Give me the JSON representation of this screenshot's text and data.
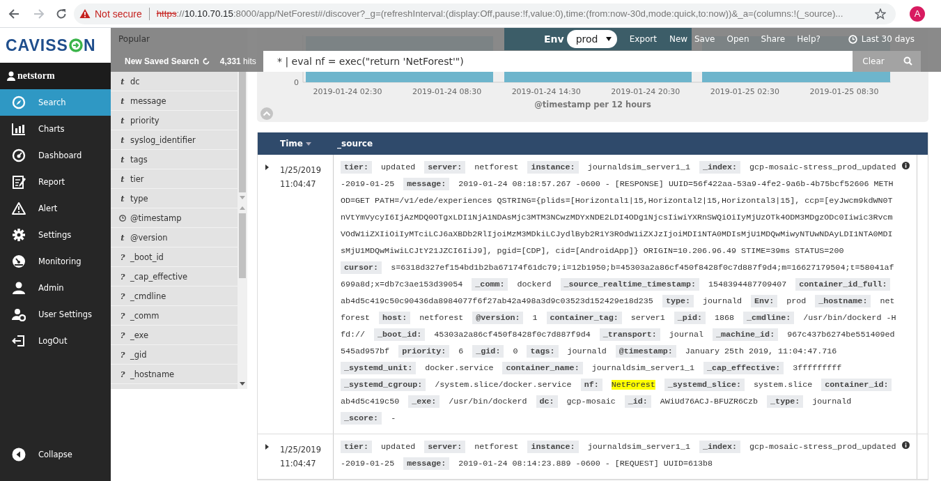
{
  "browser": {
    "security_label": "Not secure",
    "url": [
      {
        "kind": "scheme",
        "text": "https"
      },
      {
        "kind": "plain",
        "text": "://"
      },
      {
        "kind": "host",
        "text": "10.10.70.15"
      },
      {
        "kind": "plain",
        "text": ":8000/app/NetForest#/discover?_g=(refreshInterval:(display:Off,pause:!f,value:0),time:(from:now-30d,mode:quick,to:now))&_a=(columns:!(_source)..."
      }
    ],
    "forward_disabled": true,
    "avatar_letter": "A"
  },
  "sidebar": {
    "logo_parts": [
      "CAVISS",
      "N"
    ],
    "user": "netstorm",
    "items": [
      {
        "label": "Search",
        "selected": true
      },
      {
        "label": "Charts",
        "selected": false
      },
      {
        "label": "Dashboard",
        "selected": false
      },
      {
        "label": "Report",
        "selected": false
      },
      {
        "label": "Alert",
        "selected": false
      },
      {
        "label": "Settings",
        "selected": false
      },
      {
        "label": "Monitoring",
        "selected": false
      },
      {
        "label": "Admin",
        "selected": false
      },
      {
        "label": "User Settings",
        "selected": false
      },
      {
        "label": "LogOut",
        "selected": false
      }
    ],
    "collapse_label": "Collapse"
  },
  "field_list": {
    "heading": "Popular",
    "fields": [
      {
        "kind": "string",
        "type_label": "t",
        "name": "dc"
      },
      {
        "kind": "string",
        "type_label": "t",
        "name": "message"
      },
      {
        "kind": "string",
        "type_label": "t",
        "name": "priority"
      },
      {
        "kind": "string",
        "type_label": "t",
        "name": "syslog_identifier"
      },
      {
        "kind": "string",
        "type_label": "t",
        "name": "tags"
      },
      {
        "kind": "string",
        "type_label": "t",
        "name": "tier"
      },
      {
        "kind": "string",
        "type_label": "t",
        "name": "type"
      },
      {
        "kind": "date",
        "name": "@timestamp"
      },
      {
        "kind": "string",
        "type_label": "t",
        "name": "@version"
      },
      {
        "kind": "unknown",
        "type_label": "?",
        "name": "_boot_id"
      },
      {
        "kind": "unknown",
        "type_label": "?",
        "name": "_cap_effective"
      },
      {
        "kind": "unknown",
        "type_label": "?",
        "name": "_cmdline"
      },
      {
        "kind": "unknown",
        "type_label": "?",
        "name": "_comm"
      },
      {
        "kind": "unknown",
        "type_label": "?",
        "name": "_exe"
      },
      {
        "kind": "unknown",
        "type_label": "?",
        "name": "_gid"
      },
      {
        "kind": "unknown",
        "type_label": "?",
        "name": "_hostname"
      }
    ]
  },
  "toolbar": {
    "saved_search": "New Saved Search",
    "hits": "**4,331** hits",
    "env_label": "Env",
    "env_value": "prod",
    "env_actions": [
      "Export",
      "New"
    ],
    "actions": [
      "Save",
      "Open",
      "Share",
      "Help?"
    ],
    "time_range": "Last 30 days",
    "query": "* | eval nf = exec(\"return 'NetForest'\")",
    "clear_label": "Clear"
  },
  "histogram": {
    "y_tick_labels": [
      "0"
    ],
    "x_tick_labels": [
      "2019-01-24 02:30",
      "2019-01-24 08:30",
      "2019-01-24 14:30",
      "2019-01-24 20:30",
      "2019-01-25 02:30",
      "2019-01-25 08:30"
    ],
    "xlabel": "@timestamp per 12 hours"
  },
  "table": {
    "columns": [
      {
        "label": "Time",
        "sorted": true
      },
      {
        "label": "_source",
        "sorted": false
      }
    ],
    "rows": [
      {
        "expanded": false,
        "time": "1/25/2019 11:04:47",
        "fields": [
          {
            "key": "tier:",
            "value": "updated",
            "highlighted": false
          },
          {
            "key": "server:",
            "value": "netforest",
            "highlighted": false
          },
          {
            "key": "instance:",
            "value": "journaldsim_server1_1",
            "highlighted": false
          },
          {
            "key": "_index:",
            "value": "gcp-mosaic-stress_prod_updated-2019-01-25",
            "highlighted": false
          },
          {
            "key": "message:",
            "value": "2019-01-24 08:18:57.267 -0600 - [RESPONSE] UUID=56f422aa-53a9-4fe2-9a6b-4b75bcf52606 METHOD=GET PATH=/v1/ede/experiences QSTRING={plids=[Horizontal1|15,Horizontal2|15,Horizontal3|15], ccp=[eyJwcm9kdWN0TnVtYmVycyI6IjAzMDQ0OTgxLDI1NjA1NDAsMjc3MTM3NCwzMDYxNDE2LDI4ODg1NjcsIiwiYXRnSWQiOiIyMjUzOTk4ODM3MDgzODc0Iiwic3RvcmVOdW1iZXIiOiIyMTciLCJ6aXBDb2RlIjoiMzM3MDkiLCJydlByb2R1Y3ROdW1iZXJzIjoiMDI1NTA0MDIsMjU1MDQwMiwyNTUwNDAyLDI1NTA0MDIsMjU1MDQwMiwiLCJtY21JZCI6IiJ9], pgid=[CDP], cid=[AndroidApp]} ORIGIN=10.206.96.49 STIME=39ms STATUS=200",
            "highlighted": false
          },
          {
            "key": "cursor:",
            "value": "s=6318d327ef154bd1b2ba67174f61dc79;i=12b1950;b=45303a2a86cf450f8428f0c7d887f9d4;m=16627179504;t=58041af699a8d;x=db7c3ae153d39054",
            "highlighted": false
          },
          {
            "key": "_comm:",
            "value": "dockerd",
            "highlighted": false
          },
          {
            "key": "_source_realtime_timestamp:",
            "value": "1548394487709407",
            "highlighted": false
          },
          {
            "key": "container_id_full:",
            "value": "ab4d5c419c50c90436da8984077f6f27ab42a498a3d9c03523d152429e18d235",
            "highlighted": false
          },
          {
            "key": "type:",
            "value": "journald",
            "highlighted": false
          },
          {
            "key": "Env:",
            "value": "prod",
            "highlighted": false
          },
          {
            "key": "_hostname:",
            "value": "netforest",
            "highlighted": false
          },
          {
            "key": "host:",
            "value": "netforest",
            "highlighted": false
          },
          {
            "key": "@version:",
            "value": "1",
            "highlighted": false
          },
          {
            "key": "container_tag:",
            "value": "server1",
            "highlighted": false
          },
          {
            "key": "_pid:",
            "value": "1868",
            "highlighted": false
          },
          {
            "key": "_cmdline:",
            "value": "/usr/bin/dockerd -H fd://",
            "highlighted": false
          },
          {
            "key": "_boot_id:",
            "value": "45303a2a86cf450f8428f0c7d887f9d4",
            "highlighted": false
          },
          {
            "key": "_transport:",
            "value": "journal",
            "highlighted": false
          },
          {
            "key": "_machine_id:",
            "value": "967c437b6274be551409ed545ad957bf",
            "highlighted": false
          },
          {
            "key": "priority:",
            "value": "6",
            "highlighted": false
          },
          {
            "key": "_gid:",
            "value": "0",
            "highlighted": false
          },
          {
            "key": "tags:",
            "value": "journald",
            "highlighted": false
          },
          {
            "key": "@timestamp:",
            "value": "January 25th 2019, 11:04:47.716",
            "highlighted": false
          },
          {
            "key": "_systemd_unit:",
            "value": "docker.service",
            "highlighted": false
          },
          {
            "key": "container_name:",
            "value": "journaldsim_server1_1",
            "highlighted": false
          },
          {
            "key": "_cap_effective:",
            "value": "3fffffffff",
            "highlighted": false
          },
          {
            "key": "_systemd_cgroup:",
            "value": "/system.slice/docker.service",
            "highlighted": false
          },
          {
            "key": "nf:",
            "value": "NetForest",
            "highlighted": true
          },
          {
            "key": "_systemd_slice:",
            "value": "system.slice",
            "highlighted": false
          },
          {
            "key": "container_id:",
            "value": "ab4d5c419c50",
            "highlighted": false
          },
          {
            "key": "_exe:",
            "value": "/usr/bin/dockerd",
            "highlighted": false
          },
          {
            "key": "dc:",
            "value": "gcp-mosaic",
            "highlighted": false
          },
          {
            "key": "_id:",
            "value": "AWiUd76ACJ-BFUZR6Czb",
            "highlighted": false
          },
          {
            "key": "_type:",
            "value": "journald",
            "highlighted": false
          },
          {
            "key": "_score:",
            "value": "-",
            "highlighted": false
          }
        ]
      },
      {
        "expanded": false,
        "time": "1/25/2019 11:04:47",
        "fields": [
          {
            "key": "tier:",
            "value": "updated",
            "highlighted": false
          },
          {
            "key": "server:",
            "value": "netforest",
            "highlighted": false
          },
          {
            "key": "instance:",
            "value": "journaldsim_server1_1",
            "highlighted": false
          },
          {
            "key": "_index:",
            "value": "gcp-mosaic-stress_prod_updated-2019-01-25",
            "highlighted": false
          },
          {
            "key": "message:",
            "value": "2019-01-24 08:14:23.889 -0600 - [REQUEST] UUID=613b8",
            "highlighted": false
          }
        ]
      }
    ]
  }
}
